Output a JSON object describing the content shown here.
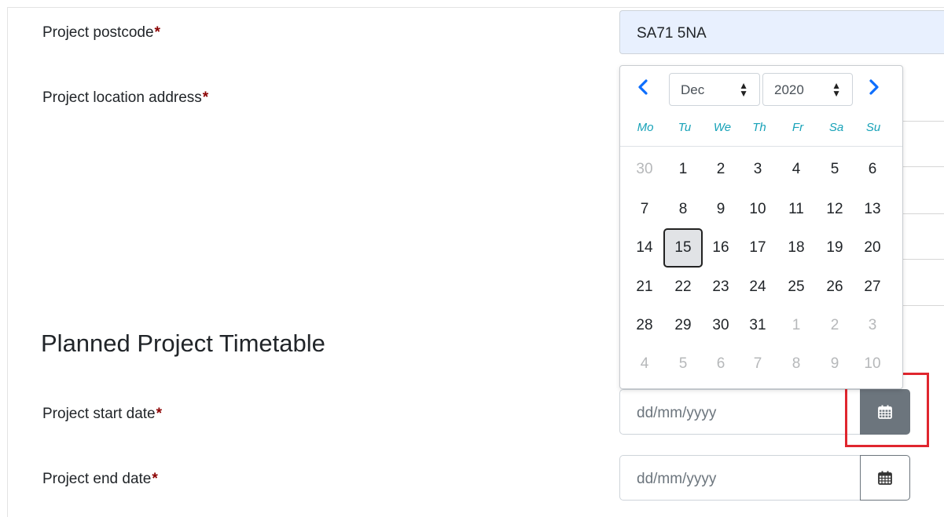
{
  "form": {
    "postcode_label": "Project postcode",
    "postcode_value": "SA71 5NA",
    "address_label": "Project location address",
    "required_mark": "*",
    "section_title": "Planned Project Timetable",
    "start_label": "Project start date",
    "start_placeholder": "dd/mm/yyyy",
    "end_label": "Project end date",
    "end_placeholder": "dd/mm/yyyy"
  },
  "datepicker": {
    "month": "Dec",
    "year": "2020",
    "weekdays": [
      "Mo",
      "Tu",
      "We",
      "Th",
      "Fr",
      "Sa",
      "Su"
    ],
    "weeks": [
      [
        {
          "d": "30",
          "m": true
        },
        {
          "d": "1"
        },
        {
          "d": "2"
        },
        {
          "d": "3"
        },
        {
          "d": "4"
        },
        {
          "d": "5"
        },
        {
          "d": "6"
        }
      ],
      [
        {
          "d": "7"
        },
        {
          "d": "8"
        },
        {
          "d": "9"
        },
        {
          "d": "10"
        },
        {
          "d": "11"
        },
        {
          "d": "12"
        },
        {
          "d": "13"
        }
      ],
      [
        {
          "d": "14"
        },
        {
          "d": "15",
          "s": true
        },
        {
          "d": "16"
        },
        {
          "d": "17"
        },
        {
          "d": "18"
        },
        {
          "d": "19"
        },
        {
          "d": "20"
        }
      ],
      [
        {
          "d": "21"
        },
        {
          "d": "22"
        },
        {
          "d": "23"
        },
        {
          "d": "24"
        },
        {
          "d": "25"
        },
        {
          "d": "26"
        },
        {
          "d": "27"
        }
      ],
      [
        {
          "d": "28"
        },
        {
          "d": "29"
        },
        {
          "d": "30"
        },
        {
          "d": "31"
        },
        {
          "d": "1",
          "m": true
        },
        {
          "d": "2",
          "m": true
        },
        {
          "d": "3",
          "m": true
        }
      ],
      [
        {
          "d": "4",
          "m": true
        },
        {
          "d": "5",
          "m": true
        },
        {
          "d": "6",
          "m": true
        },
        {
          "d": "7",
          "m": true
        },
        {
          "d": "8",
          "m": true
        },
        {
          "d": "9",
          "m": true
        },
        {
          "d": "10",
          "m": true
        }
      ]
    ]
  },
  "colors": {
    "nav_arrow": "#0d6efd",
    "weekday": "#17a2b8",
    "required": "#8b0000",
    "highlight": "#e0262e",
    "active_button": "#6c757d"
  },
  "icons": {
    "prev": "chevron-left-icon",
    "next": "chevron-right-icon",
    "calendar": "calendar-icon"
  }
}
